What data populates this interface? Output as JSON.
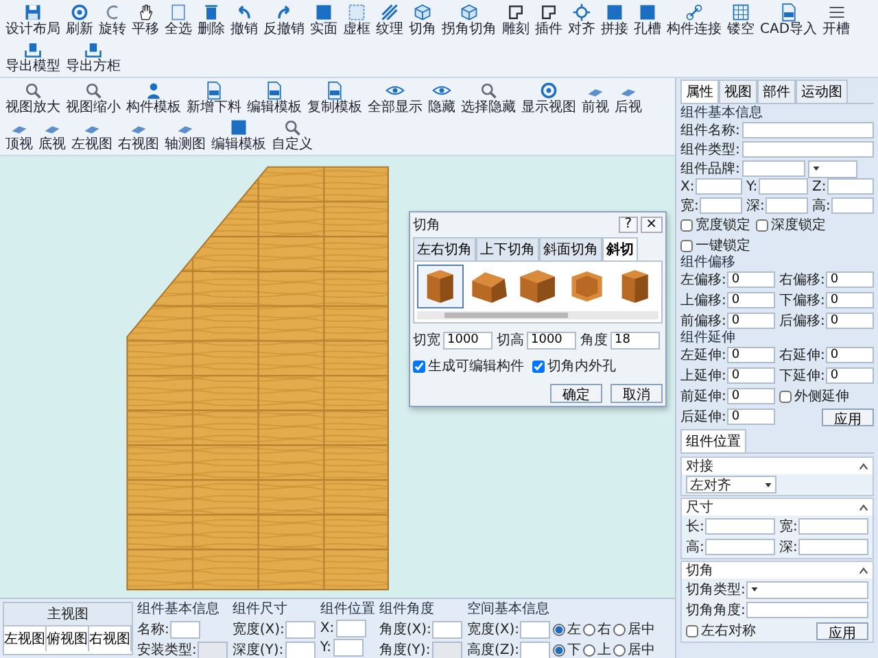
{
  "toolbar": {
    "items": [
      {
        "label": "设计布局",
        "kind": "floppy"
      },
      {
        "label": "刷新",
        "kind": "circle"
      },
      {
        "label": "旋转",
        "kind": "arc"
      },
      {
        "label": "平移",
        "kind": "hand"
      },
      {
        "label": "全选",
        "kind": "page"
      },
      {
        "label": "删除",
        "kind": "trash"
      },
      {
        "label": "撤销",
        "kind": "undo"
      },
      {
        "label": "反撤销",
        "kind": "redo"
      },
      {
        "label": "实面",
        "kind": "square"
      },
      {
        "label": "虚框",
        "kind": "dashed"
      },
      {
        "label": "纹理",
        "kind": "hatch"
      },
      {
        "label": "切角",
        "kind": "cube"
      },
      {
        "label": "拐角切角",
        "kind": "cube"
      },
      {
        "label": "雕刻",
        "kind": "notch"
      },
      {
        "label": "插件",
        "kind": "notch"
      },
      {
        "label": "对齐",
        "kind": "crosshair"
      },
      {
        "label": "拼接",
        "kind": "square"
      },
      {
        "label": "孔槽",
        "kind": "square"
      },
      {
        "label": "构件连接",
        "kind": "link"
      },
      {
        "label": "镂空",
        "kind": "grid"
      },
      {
        "label": "CAD导入",
        "kind": "doc"
      },
      {
        "label": "开槽",
        "kind": "lines"
      },
      {
        "label": "导出模型",
        "kind": "tray"
      },
      {
        "label": "导出方柜",
        "kind": "tray"
      }
    ]
  },
  "view_toolbar": {
    "items": [
      {
        "label": "视图放大",
        "kind": "zoom"
      },
      {
        "label": "视图缩小",
        "kind": "zoom"
      },
      {
        "label": "构件模板",
        "kind": "person"
      },
      {
        "label": "新增下料",
        "kind": "doc"
      },
      {
        "label": "编辑模板",
        "kind": "doc"
      },
      {
        "label": "复制模板",
        "kind": "doc"
      },
      {
        "label": "全部显示",
        "kind": "eye"
      },
      {
        "label": "隐藏",
        "kind": "eye"
      },
      {
        "label": "选择隐藏",
        "kind": "zoom"
      },
      {
        "label": "显示视图",
        "kind": "circle"
      },
      {
        "label": "前视",
        "kind": "panel"
      },
      {
        "label": "后视",
        "kind": "panel"
      },
      {
        "label": "顶视",
        "kind": "panel"
      },
      {
        "label": "底视",
        "kind": "panel"
      },
      {
        "label": "左视图",
        "kind": "panel"
      },
      {
        "label": "右视图",
        "kind": "panel"
      },
      {
        "label": "轴测图",
        "kind": "panel"
      },
      {
        "label": "编辑模板",
        "kind": "square"
      },
      {
        "label": "自定义",
        "kind": "zoom"
      }
    ]
  },
  "dialog": {
    "title": "切角",
    "help_button": "?",
    "close_button": "×",
    "tabs": [
      {
        "label": "左右切角",
        "selected": false
      },
      {
        "label": "上下切角",
        "selected": false
      },
      {
        "label": "斜面切角",
        "selected": false
      },
      {
        "label": "斜切",
        "selected": true
      }
    ],
    "thumbnails": [
      {
        "kind": "slab",
        "selected": true
      },
      {
        "kind": "bevel",
        "selected": false
      },
      {
        "kind": "box",
        "selected": false
      },
      {
        "kind": "chamfer",
        "selected": false
      },
      {
        "kind": "slab",
        "selected": false
      }
    ],
    "fields": [
      {
        "label": "切宽",
        "value": "1000"
      },
      {
        "label": "切高",
        "value": "1000"
      },
      {
        "label": "角度",
        "value": "18"
      }
    ],
    "checks": [
      {
        "label": "生成可编辑构件",
        "checked": true
      },
      {
        "label": "切角内外孔",
        "checked": true
      }
    ],
    "buttons": [
      "确定",
      "取消"
    ]
  },
  "properties_panel": {
    "tabs": [
      {
        "label": "属性",
        "selected": true
      },
      {
        "label": "视图",
        "selected": false
      },
      {
        "label": "部件",
        "selected": false
      },
      {
        "label": "运动图",
        "selected": false
      }
    ],
    "basic": {
      "title": "组件基本信息",
      "fields": [
        {
          "kind": "text",
          "label": "组件名称:"
        },
        {
          "kind": "text",
          "label": "组件类型:"
        },
        {
          "kind": "text_select",
          "label": "组件品牌:"
        }
      ]
    },
    "coords": [
      {
        "label": "X:"
      },
      {
        "label": "Y:"
      },
      {
        "label": "Z:"
      },
      {
        "label": "宽:"
      },
      {
        "label": "深:"
      },
      {
        "label": "高:"
      }
    ],
    "locks": [
      {
        "label": "宽度锁定",
        "checked": false
      },
      {
        "label": "深度锁定",
        "checked": false
      },
      {
        "label": "一键锁定",
        "checked": false
      }
    ],
    "sections": [
      {
        "title": "组件偏移",
        "cells": [
          {
            "kind": "field",
            "label": "左偏移:",
            "value": "0"
          },
          {
            "kind": "field",
            "label": "右偏移:",
            "value": "0"
          },
          {
            "kind": "field",
            "label": "上偏移:",
            "value": "0"
          },
          {
            "kind": "field",
            "label": "下偏移:",
            "value": "0"
          },
          {
            "kind": "field",
            "label": "前偏移:",
            "value": "0"
          },
          {
            "kind": "field",
            "label": "后偏移:",
            "value": "0"
          }
        ]
      },
      {
        "title": "组件延伸",
        "cells": [
          {
            "kind": "field",
            "label": "左延伸:",
            "value": "0"
          },
          {
            "kind": "field",
            "label": "右延伸:",
            "value": "0"
          },
          {
            "kind": "field",
            "label": "上延伸:",
            "value": "0"
          },
          {
            "kind": "field",
            "label": "下延伸:",
            "value": "0"
          },
          {
            "kind": "field",
            "label": "前延伸:",
            "value": "0"
          },
          {
            "kind": "check",
            "label": "外侧延伸",
            "checked": false
          },
          {
            "kind": "field",
            "label": "后延伸:",
            "value": "0"
          },
          {
            "kind": "button",
            "label": "应用"
          }
        ]
      }
    ],
    "position_tab": "组件位置",
    "groups": [
      {
        "title": "对接",
        "cells": [
          {
            "kind": "select",
            "value": "左对齐"
          }
        ]
      },
      {
        "title": "尺寸",
        "cells": [
          {
            "kind": "field",
            "label": "长:"
          },
          {
            "kind": "field",
            "label": "宽:"
          },
          {
            "kind": "field",
            "label": "高:"
          },
          {
            "kind": "field",
            "label": "深:"
          }
        ]
      },
      {
        "title": "切角",
        "cells": [
          {
            "kind": "select_row",
            "label": "切角类型:"
          },
          {
            "kind": "field_row",
            "label": "切角角度:"
          },
          {
            "kind": "check",
            "label": "左右对称",
            "checked": false
          },
          {
            "kind": "button",
            "label": "应用"
          }
        ]
      }
    ]
  },
  "bottom_panel": {
    "main_view": {
      "title": "主视图",
      "views": [
        "左视图",
        "俯视图",
        "右视图"
      ]
    },
    "sections": [
      {
        "title": "组件基本信息",
        "cells": [
          {
            "kind": "field",
            "label": "名称:",
            "disabled": false
          },
          {
            "kind": "field",
            "label": "安装类型:",
            "disabled": true
          }
        ]
      },
      {
        "title": "组件尺寸",
        "cells": [
          {
            "kind": "field",
            "label": "宽度(X):",
            "disabled": false
          },
          {
            "kind": "field",
            "label": "深度(Y):",
            "disabled": false
          }
        ]
      },
      {
        "title": "组件位置",
        "cells": [
          {
            "kind": "field",
            "label": "X:",
            "disabled": false
          },
          {
            "kind": "field",
            "label": "Y:",
            "disabled": false
          }
        ]
      },
      {
        "title": "组件角度",
        "cells": [
          {
            "kind": "field",
            "label": "角度(X):",
            "disabled": false
          },
          {
            "kind": "field",
            "label": "角度(Y):",
            "disabled": true
          }
        ]
      },
      {
        "title": "空间基本信息",
        "cells": [
          {
            "kind": "field_radio",
            "label": "宽度(X):",
            "disabled": false,
            "options": [
              {
                "label": "左",
                "selected": true
              },
              {
                "label": "右",
                "selected": false
              },
              {
                "label": "居中",
                "selected": false
              }
            ]
          },
          {
            "kind": "field_radio",
            "label": "高度(Z):",
            "disabled": false,
            "options": [
              {
                "label": "下",
                "selected": true
              },
              {
                "label": "上",
                "selected": false
              },
              {
                "label": "居中",
                "selected": false
              }
            ]
          }
        ]
      }
    ]
  }
}
